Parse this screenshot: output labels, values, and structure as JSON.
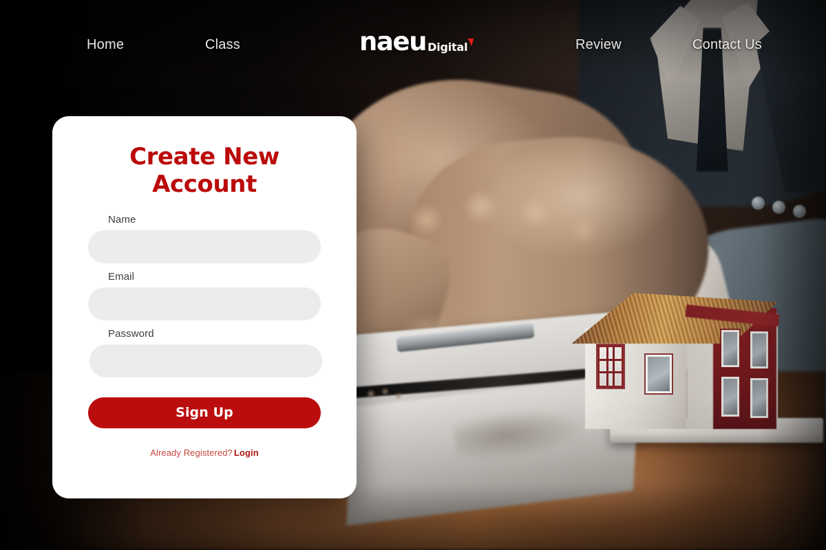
{
  "nav": {
    "items": [
      {
        "id": "home",
        "label": "Home"
      },
      {
        "id": "class",
        "label": "Class"
      },
      {
        "id": "review",
        "label": "Review"
      },
      {
        "id": "contact",
        "label": "Contact Us"
      }
    ],
    "logo": {
      "mark": "naeu",
      "sub": "Digital",
      "accent_color": "#e01b18"
    }
  },
  "card": {
    "title": "Create New Account",
    "title_color": "#bb0a0a",
    "fields": [
      {
        "id": "name",
        "label": "Name",
        "value": "",
        "placeholder": ""
      },
      {
        "id": "email",
        "label": "Email",
        "value": "",
        "placeholder": ""
      },
      {
        "id": "password",
        "label": "Password",
        "value": "",
        "placeholder": ""
      }
    ],
    "submit": {
      "label": "Sign Up",
      "background": "#bb0d0d",
      "text_color": "#ffffff"
    },
    "footer": {
      "prompt": "Already Registered?",
      "link_label": "Login",
      "prompt_color": "#c6463f",
      "link_color": "#b01410"
    }
  },
  "background": {
    "description": "Business handshake over a desk with a model house and documents",
    "base_color": "#080606",
    "desk_color": "#b9753f",
    "house_accent": "#8f2226",
    "roof_color": "#d8a04a"
  }
}
